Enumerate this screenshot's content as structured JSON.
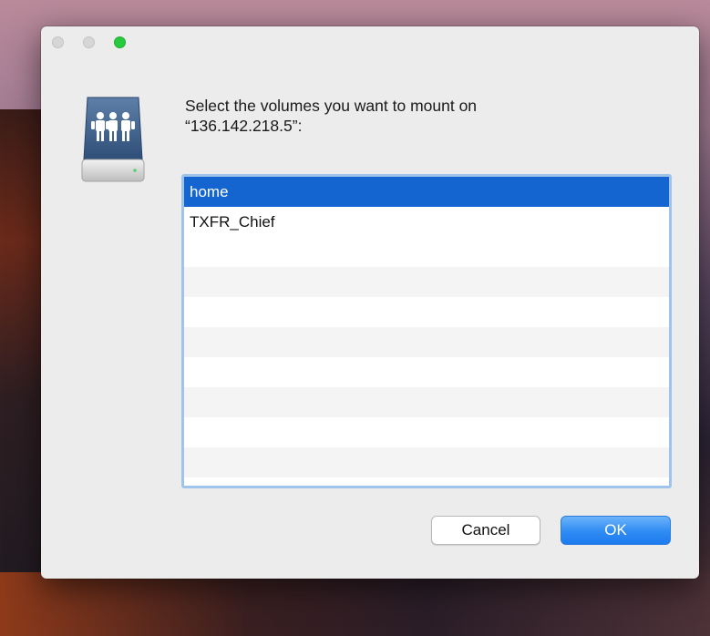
{
  "dialog": {
    "prompt_line1": "Select the volumes you want to mount on",
    "prompt_line2": "“136.142.218.5”:",
    "icon": "network-share-drive-icon"
  },
  "volumes": {
    "items": [
      "home",
      "TXFR_Chief",
      "",
      "",
      "",
      "",
      "",
      "",
      "",
      ""
    ],
    "selected": "home"
  },
  "buttons": {
    "cancel_label": "Cancel",
    "ok_label": "OK"
  },
  "colors": {
    "selection": "#1565d0",
    "focus_ring": "#9ec4ec",
    "ok_button": "#2f8bf3",
    "zoom_light": "#27c93f"
  }
}
